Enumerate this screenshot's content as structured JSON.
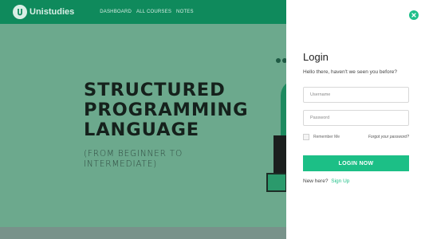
{
  "app": {
    "name": "Unistudies",
    "nav": [
      "DASHBOARD",
      "ALL COURSES",
      "NOTES"
    ]
  },
  "hero": {
    "title_lines": [
      "STRUCTURED",
      "PROGRAMMING",
      "LANGUAGE"
    ],
    "subtitle_lines": [
      "(FROM BEGINNER TO",
      "INTERMEDIATE)"
    ]
  },
  "login": {
    "title": "Login",
    "subtitle": "Hello there, haven't we seen you before?",
    "username_placeholder": "Username",
    "password_placeholder": "Password",
    "remember_label": "Remember Me",
    "forgot_label": "Forgot your password?",
    "submit_label": "LOGIN NOW",
    "new_here_text": "New here?",
    "signup_label": "Sign Up"
  },
  "colors": {
    "brand": "#0f8a5c",
    "accent": "#1cbf86",
    "overlay": "#6ca98d"
  },
  "icons": {
    "logo": "unistudies-logo-icon",
    "close": "close-icon"
  }
}
